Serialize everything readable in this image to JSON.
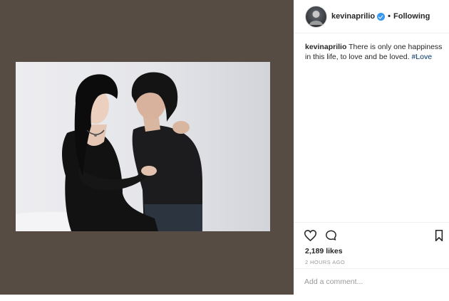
{
  "post": {
    "username": "kevinaprilio",
    "separator": "•",
    "follow_status": "Following",
    "caption_username": "kevinaprilio",
    "caption_text": "There is only one happiness in this life, to love and be loved.",
    "hashtag": "#Love",
    "likes": "2,189 likes",
    "timestamp": "2 HOURS AGO"
  },
  "comment_box": {
    "placeholder": "Add a comment..."
  },
  "colors": {
    "media_background": "#564c43",
    "link": "#003569",
    "verified": "#3897f0",
    "muted_text": "#999999"
  },
  "icons": {
    "avatar": "avatar",
    "verified": "verified-badge-icon",
    "like": "heart-icon",
    "comment": "comment-icon",
    "save": "bookmark-icon"
  }
}
